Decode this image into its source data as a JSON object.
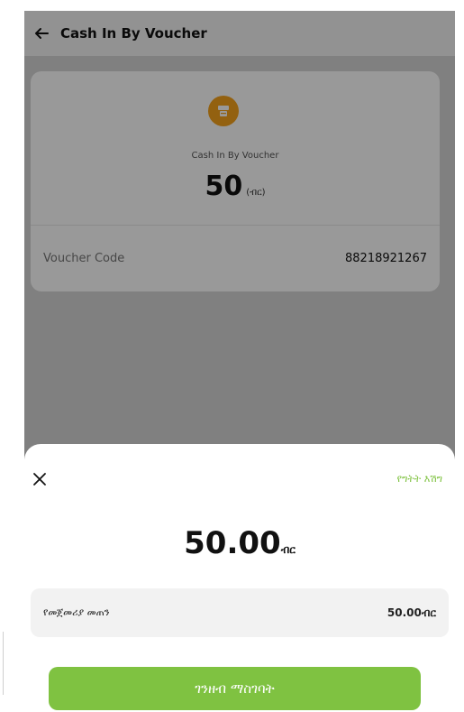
{
  "header": {
    "title": "Cash In By Voucher"
  },
  "card": {
    "subtitle": "Cash In By Voucher",
    "amount": "50",
    "currency_label": "(ብር)",
    "voucher_label": "Voucher Code",
    "voucher_value": "88218921267"
  },
  "sheet": {
    "help_text": "የግትት እሽግ",
    "amount": "50.00",
    "currency_suffix": "ብር",
    "info_label": "የመጀመሪያ መጠን",
    "info_value": "50.00ብር",
    "cta_label": "ገንዘብ ማስገባት"
  },
  "colors": {
    "accent_green": "#7fc241",
    "icon_orange": "#f6a21c"
  },
  "icons": {
    "back": "arrow-left-icon",
    "voucher": "receipt-icon",
    "close": "close-icon"
  }
}
